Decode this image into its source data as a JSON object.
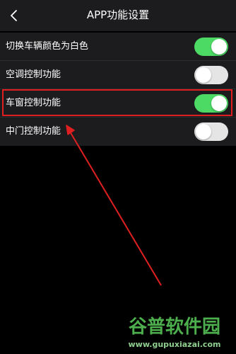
{
  "header": {
    "title": "APP功能设置",
    "back_icon": "chevron-left-icon"
  },
  "settings": [
    {
      "label": "切换车辆颜色为白色",
      "enabled": true
    },
    {
      "label": "空调控制功能",
      "enabled": false
    },
    {
      "label": "车窗控制功能",
      "enabled": true
    },
    {
      "label": "中门控制功能",
      "enabled": false
    }
  ],
  "colors": {
    "toggle_on": "#4cd964",
    "toggle_off": "#e5e5e5",
    "highlight": "#e02020",
    "background": "#000000",
    "list_background": "#1c1c1e"
  },
  "watermark": {
    "logo_text": "谷普软件园",
    "url": "www.gupuxiazai.com"
  }
}
